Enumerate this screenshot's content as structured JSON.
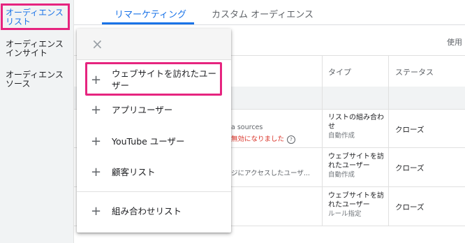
{
  "sidebar": {
    "items": [
      {
        "label": "オーディエンス\nリスト",
        "active": true
      },
      {
        "label": "オーディエンス\nインサイト",
        "active": false
      },
      {
        "label": "オーディエンス\nソース",
        "active": false
      }
    ]
  },
  "tabs": [
    {
      "label": "リマーケティング",
      "active": true
    },
    {
      "label": "カスタム オーディエンス",
      "active": false
    }
  ],
  "table": {
    "usage_label": "使用",
    "headers": {
      "type": "タイプ",
      "status": "ステータス"
    },
    "rows": [
      {
        "source_line1": "a sources",
        "source_line2": "無効になりました",
        "type": "リストの組み合わせ",
        "type_sub": "自動作成",
        "status": "クローズ"
      },
      {
        "source_line1": "ジにアクセスしたユーザ...",
        "type": "ウェブサイトを訪れたユーザー",
        "type_sub": "自動作成",
        "status": "クローズ"
      },
      {
        "type": "ウェブサイトを訪れたユーザー",
        "type_sub": "ルール指定",
        "status": "クローズ"
      }
    ]
  },
  "menu": {
    "close_icon": "×",
    "plus_icon": "+",
    "help_icon": "?",
    "items": [
      {
        "label": "ウェブサイトを訪れたユー\nザー"
      },
      {
        "label": "アプリユーザー"
      },
      {
        "label": "YouTube ユーザー"
      },
      {
        "label": "顧客リスト"
      },
      {
        "label": "組み合わせリスト"
      }
    ]
  },
  "colors": {
    "highlight": "#e6247f",
    "accent": "#1a73e8",
    "error": "#d93025"
  }
}
